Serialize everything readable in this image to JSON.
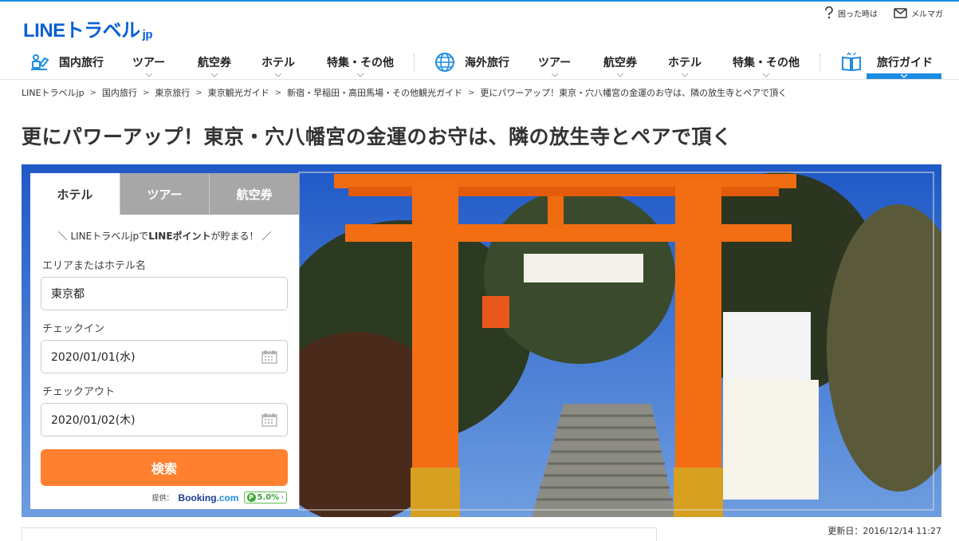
{
  "brand": {
    "logo_main": "LINEトラベル",
    "logo_suffix": "jp",
    "accent": "#1d8de2"
  },
  "util": {
    "help": "困った時は",
    "mail": "メルマガ"
  },
  "nav": {
    "domestic": "国内旅行",
    "d_tour": "ツアー",
    "d_flight": "航空券",
    "d_hotel": "ホテル",
    "d_feature": "特集・その他",
    "overseas": "海外旅行",
    "o_tour": "ツアー",
    "o_flight": "航空券",
    "o_hotel": "ホテル",
    "o_feature": "特集・その他",
    "guide": "旅行ガイド"
  },
  "breadcrumb": [
    "LINEトラベルjp",
    "国内旅行",
    "東京旅行",
    "東京観光ガイド",
    "新宿・早稲田・高田馬場・その他観光ガイド",
    "更にパワーアップ！東京・穴八幡宮の金運のお守は、隣の放生寺とペアで頂く"
  ],
  "page_title": "更にパワーアップ！東京・穴八幡宮の金運のお守は、隣の放生寺とペアで頂く",
  "search": {
    "tabs": [
      "ホテル",
      "ツアー",
      "航空券"
    ],
    "promo_pre": "＼ LINEトラベルjpで",
    "promo_bold": "LINEポイント",
    "promo_post": "が貯まる！ ／",
    "area_label": "エリアまたはホテル名",
    "area_value": "東京都",
    "checkin_label": "チェックイン",
    "checkin_value": "2020/01/01(水)",
    "checkout_label": "チェックアウト",
    "checkout_value": "2020/01/02(木)",
    "button": "検索",
    "provider_label": "提供：",
    "provider_name": "Booking",
    "provider_tld": ".com",
    "points_rate": "5.0%",
    "button_color": "#ff8130"
  },
  "updated": "更新日：2016/12/14 11:27"
}
